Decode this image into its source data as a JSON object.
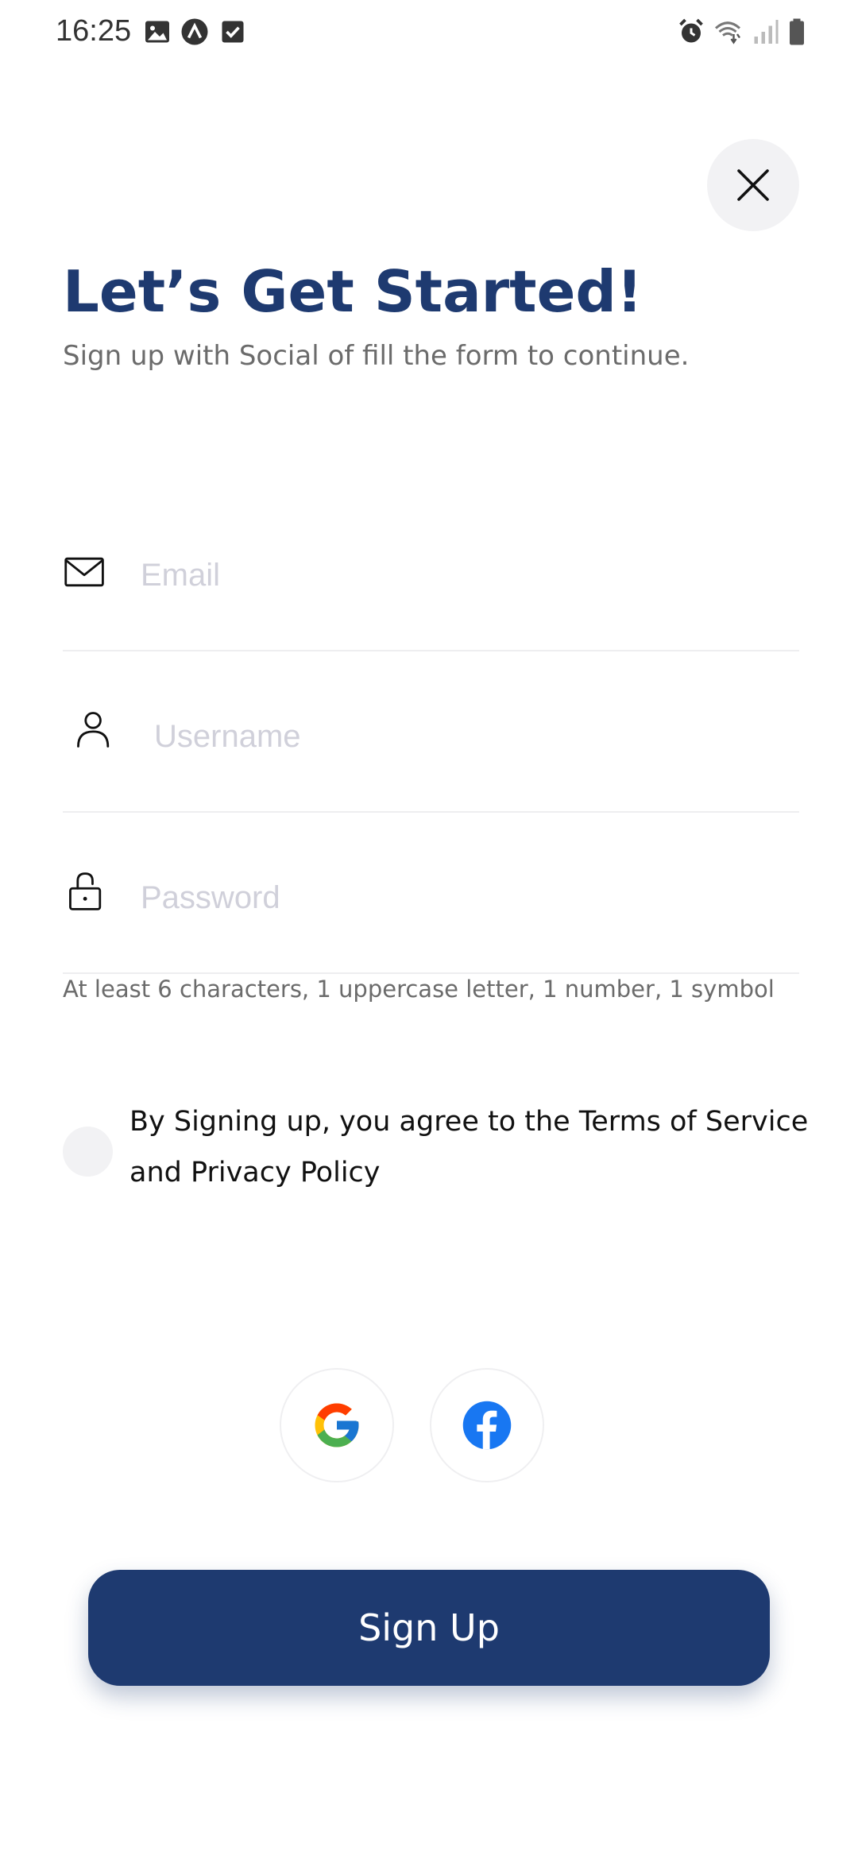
{
  "status_bar": {
    "time": "16:25",
    "left_icons": [
      "image-icon",
      "app-icon",
      "checkbox-icon"
    ],
    "right_icons": [
      "alarm-icon",
      "wifi-icon",
      "signal-icon",
      "battery-icon"
    ]
  },
  "header": {
    "title": "Let’s Get Started!",
    "subtitle": "Sign up with Social of fill the form to continue."
  },
  "form": {
    "email": {
      "placeholder": "Email",
      "value": ""
    },
    "username": {
      "placeholder": "Username",
      "value": ""
    },
    "password": {
      "placeholder": "Password",
      "value": ""
    },
    "password_hint": "At least 6 characters, 1 uppercase letter, 1 number, 1 symbol"
  },
  "terms": {
    "text": "By Signing up, you agree to the Terms of Service and Privacy Policy",
    "checked": false
  },
  "social": {
    "providers": [
      "google-icon",
      "facebook-icon"
    ]
  },
  "actions": {
    "signup_label": "Sign Up"
  },
  "colors": {
    "primary": "#1e3a70",
    "facebook": "#1877f2",
    "input_placeholder": "#d0d0da",
    "muted": "#6b6b6b"
  }
}
